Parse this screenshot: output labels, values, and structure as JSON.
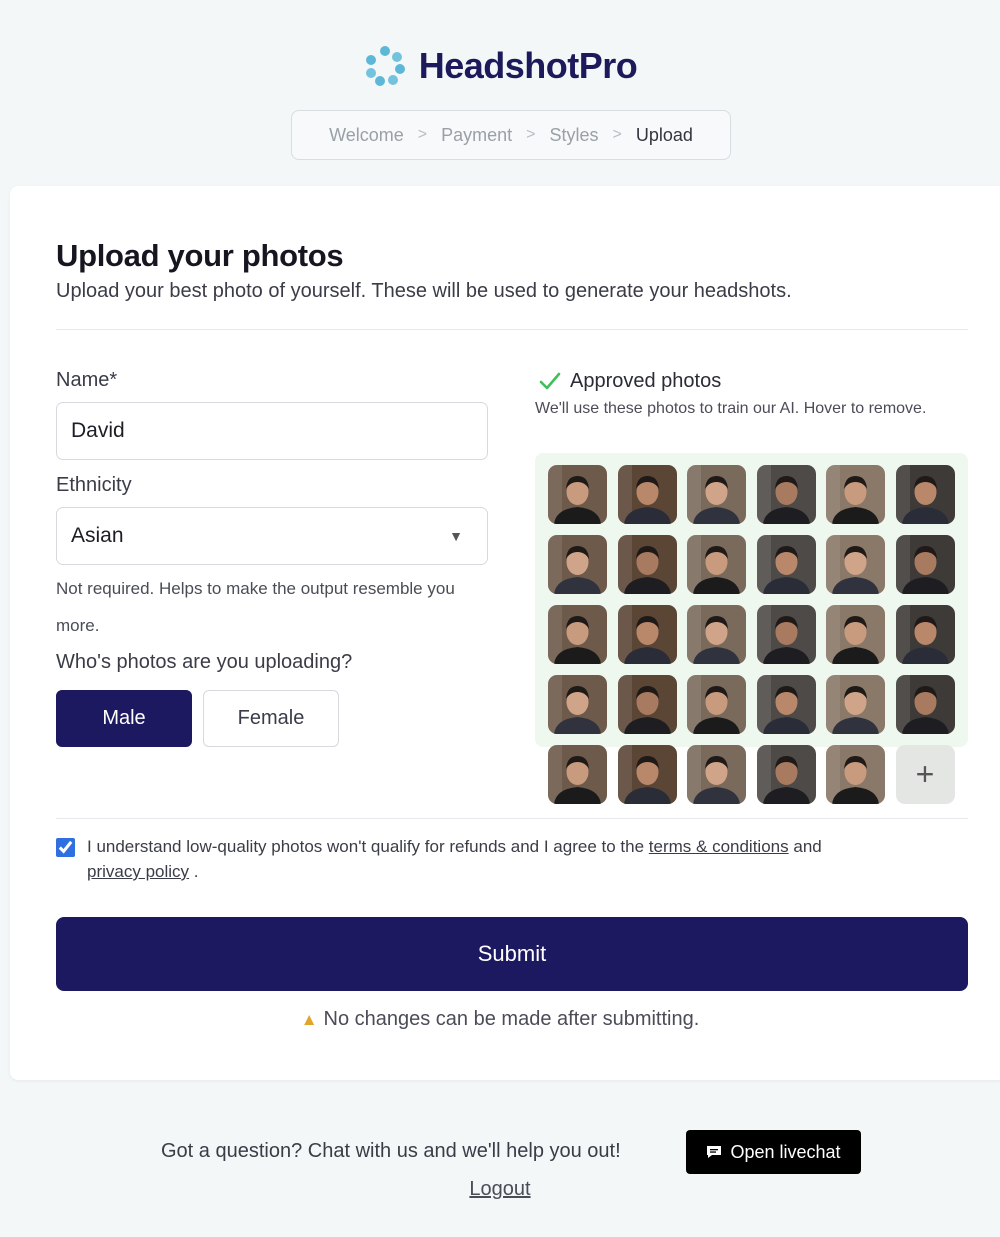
{
  "brand": {
    "name": "HeadshotPro"
  },
  "breadcrumb": {
    "steps": [
      "Welcome",
      "Payment",
      "Styles",
      "Upload"
    ],
    "separator": ">",
    "current_index": 3
  },
  "page": {
    "title": "Upload your photos",
    "subtitle": "Upload your best photo of yourself. These will be used to generate your headshots."
  },
  "form": {
    "name_label": "Name*",
    "name_value": "David",
    "ethnicity_label": "Ethnicity",
    "ethnicity_value": "Asian",
    "ethnicity_caret": "▼",
    "ethnicity_help": "Not required. Helps to make the output resemble you more.",
    "gender_question": "Who's photos are you uploading?",
    "gender_options": [
      "Male",
      "Female"
    ],
    "gender_selected": "Male"
  },
  "approved": {
    "title": "Approved photos",
    "subtitle": "We'll use these photos to train our AI. Hover to remove.",
    "photo_count": 29,
    "add_label": "+"
  },
  "agreement": {
    "checked": true,
    "text_before": "I understand low-quality photos won't qualify for refunds and I agree to the",
    "terms_link": "terms & conditions",
    "text_mid": "and",
    "privacy_link": "privacy policy",
    "text_after": "."
  },
  "submit": {
    "label": "Submit",
    "warning": "No changes can be made after submitting.",
    "warning_icon": "▲"
  },
  "footer": {
    "question": "Got a question? Chat with us and we'll help you out!",
    "livechat_label": "Open livechat",
    "logout_label": "Logout"
  },
  "colors": {
    "primary": "#1d1960",
    "background": "#f3f7f8",
    "approved_bg": "#eef8ee",
    "check_green": "#3fbf5c",
    "warning_yellow": "#e0a52a",
    "logo_blue": "#5db8d8"
  }
}
